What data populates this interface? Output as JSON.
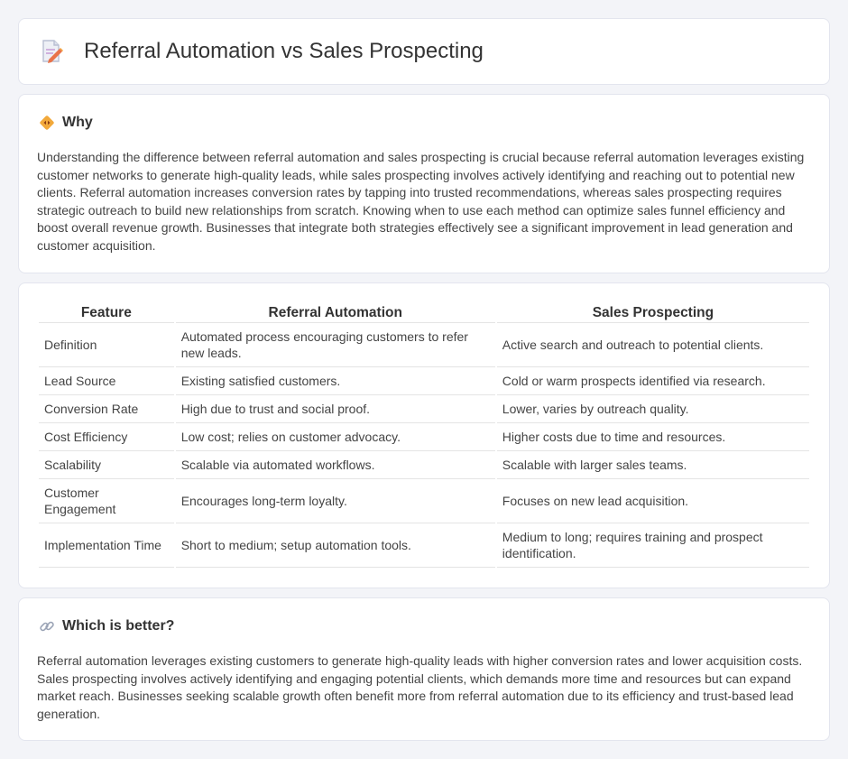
{
  "page": {
    "title": "Referral Automation vs Sales Prospecting",
    "title_icon": "document-pencil-icon"
  },
  "why": {
    "icon": "diamond-arrows-icon",
    "title": "Why",
    "text": "Understanding the difference between referral automation and sales prospecting is crucial because referral automation leverages existing customer networks to generate high-quality leads, while sales prospecting involves actively identifying and reaching out to potential new clients. Referral automation increases conversion rates by tapping into trusted recommendations, whereas sales prospecting requires strategic outreach to build new relationships from scratch. Knowing when to use each method can optimize sales funnel efficiency and boost overall revenue growth. Businesses that integrate both strategies effectively see a significant improvement in lead generation and customer acquisition."
  },
  "table": {
    "headers": [
      "Feature",
      "Referral Automation",
      "Sales Prospecting"
    ],
    "rows": [
      [
        "Definition",
        "Automated process encouraging customers to refer new leads.",
        "Active search and outreach to potential clients."
      ],
      [
        "Lead Source",
        "Existing satisfied customers.",
        "Cold or warm prospects identified via research."
      ],
      [
        "Conversion Rate",
        "High due to trust and social proof.",
        "Lower, varies by outreach quality."
      ],
      [
        "Cost Efficiency",
        "Low cost; relies on customer advocacy.",
        "Higher costs due to time and resources."
      ],
      [
        "Scalability",
        "Scalable via automated workflows.",
        "Scalable with larger sales teams."
      ],
      [
        "Customer Engagement",
        "Encourages long-term loyalty.",
        "Focuses on new lead acquisition."
      ],
      [
        "Implementation Time",
        "Short to medium; setup automation tools.",
        "Medium to long; requires training and prospect identification."
      ]
    ]
  },
  "better": {
    "icon": "link-icon",
    "title": "Which is better?",
    "text": "Referral automation leverages existing customers to generate high-quality leads with higher conversion rates and lower acquisition costs. Sales prospecting involves actively identifying and engaging potential clients, which demands more time and resources but can expand market reach. Businesses seeking scalable growth often benefit more from referral automation due to its efficiency and trust-based lead generation."
  }
}
